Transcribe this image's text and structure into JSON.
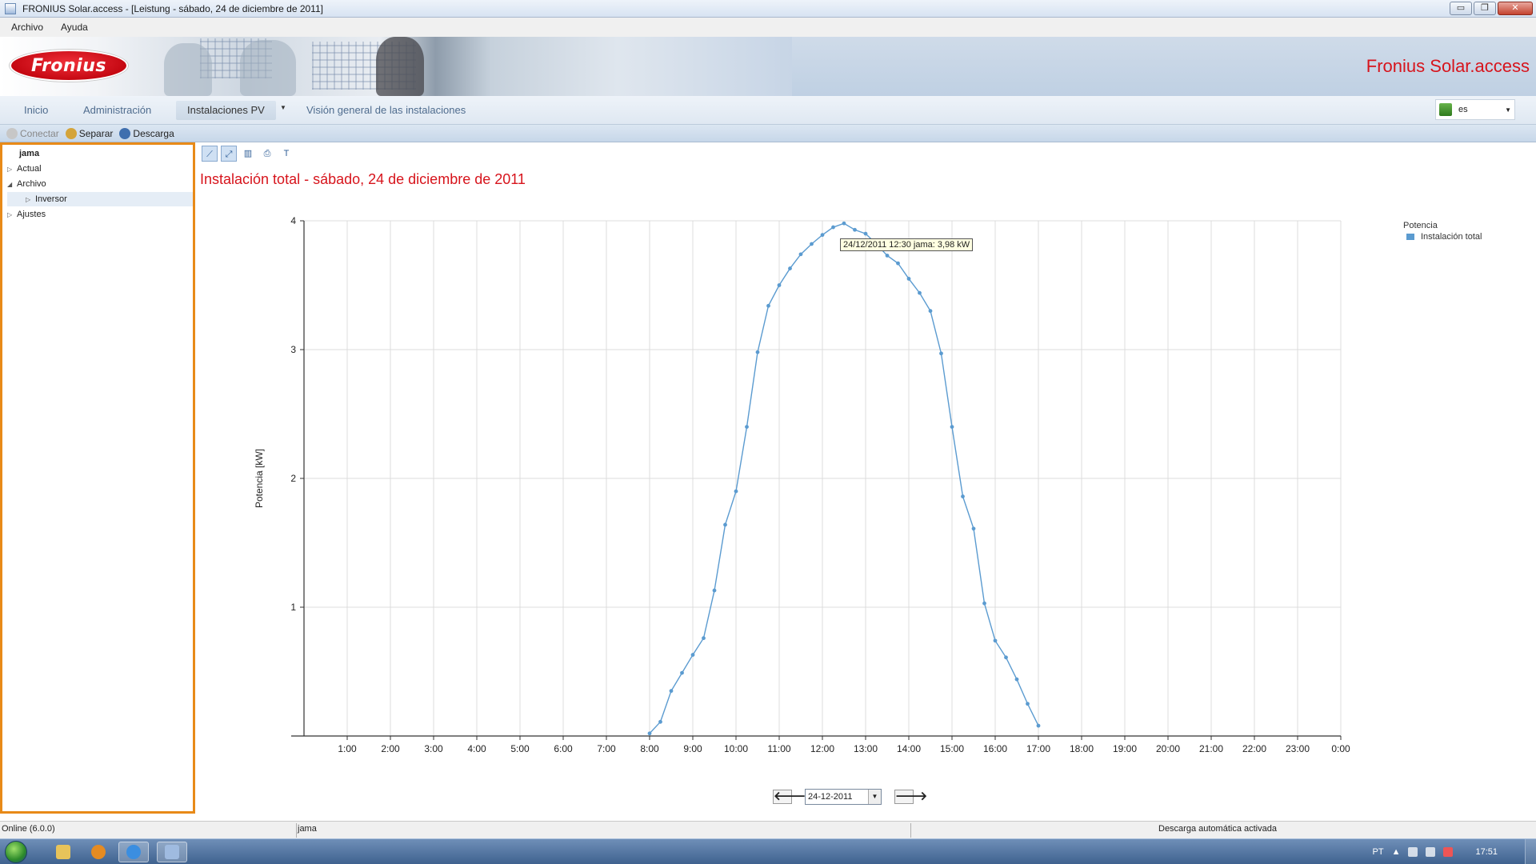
{
  "window": {
    "title": "FRONIUS Solar.access - [Leistung - sábado, 24 de diciembre de 2011]",
    "controls": {
      "minimize": "▭",
      "restore": "❐",
      "close": "✕"
    }
  },
  "menu": {
    "items": [
      "Archivo",
      "Ayuda"
    ]
  },
  "banner": {
    "logo_text": "Fronius",
    "title": "Fronius Solar.access"
  },
  "tabs": [
    {
      "label": "Inicio"
    },
    {
      "label": "Administración"
    },
    {
      "label": "Instalaciones PV",
      "active": true
    },
    {
      "label": "Visión general de las instalaciones"
    }
  ],
  "language": {
    "value": "es"
  },
  "toolbar": {
    "connect": "Conectar",
    "disconnect": "Separar",
    "download": "Descarga"
  },
  "tree": {
    "root": "jama",
    "items": [
      {
        "label": "Actual",
        "expanded": false
      },
      {
        "label": "Archivo",
        "expanded": true
      },
      {
        "label": "Inversor",
        "expanded": false,
        "selected": true
      },
      {
        "label": "Ajustes",
        "expanded": false
      }
    ]
  },
  "chart_tools": {
    "t_label": "T"
  },
  "chart_title": "Instalación total - sábado, 24 de diciembre de 2011",
  "tooltip": "24/12/2011 12:30 jama: 3,98 kW",
  "date_nav": {
    "value": "24-12-2011",
    "prev": "🡐",
    "next": "🡒"
  },
  "colors": {
    "accent": "#d7141c",
    "series": "#5b9bd0",
    "panel_border": "#e88a18"
  },
  "chart_data": {
    "type": "line",
    "ylabel": "Potencia [kW]",
    "xlabel": "",
    "ylim": [
      0,
      4
    ],
    "yticks": [
      1,
      2,
      3,
      4
    ],
    "xlim": [
      0,
      24
    ],
    "xticks": [
      "1:00",
      "2:00",
      "3:00",
      "4:00",
      "5:00",
      "6:00",
      "7:00",
      "8:00",
      "9:00",
      "10:00",
      "11:00",
      "12:00",
      "13:00",
      "14:00",
      "15:00",
      "16:00",
      "17:00",
      "18:00",
      "19:00",
      "20:00",
      "21:00",
      "22:00",
      "23:00",
      "0:00"
    ],
    "grid": true,
    "legend": {
      "title": "Potencia",
      "position": "top-right"
    },
    "series": [
      {
        "name": "Instalación total",
        "x": [
          "8:00",
          "8:15",
          "8:30",
          "8:45",
          "9:00",
          "9:15",
          "9:30",
          "9:45",
          "10:00",
          "10:15",
          "10:30",
          "10:45",
          "11:00",
          "11:15",
          "11:30",
          "11:45",
          "12:00",
          "12:15",
          "12:30",
          "12:45",
          "13:00",
          "13:15",
          "13:30",
          "13:45",
          "14:00",
          "14:15",
          "14:30",
          "14:45",
          "15:00",
          "15:15",
          "15:30",
          "15:45",
          "16:00",
          "16:15",
          "16:30",
          "16:45",
          "17:00"
        ],
        "values": [
          0.02,
          0.11,
          0.35,
          0.49,
          0.63,
          0.76,
          1.13,
          1.64,
          1.9,
          2.4,
          2.98,
          3.34,
          3.5,
          3.63,
          3.74,
          3.82,
          3.89,
          3.95,
          3.98,
          3.93,
          3.9,
          3.82,
          3.73,
          3.67,
          3.55,
          3.44,
          3.3,
          2.97,
          2.4,
          1.86,
          1.61,
          1.03,
          0.74,
          0.61,
          0.44,
          0.25,
          0.08
        ]
      }
    ]
  },
  "status": {
    "connection": "Online (6.0.0)",
    "plant": "jama",
    "download": "Descarga automática activada"
  },
  "taskbar": {
    "locale": "PT",
    "clock": "17:51"
  }
}
